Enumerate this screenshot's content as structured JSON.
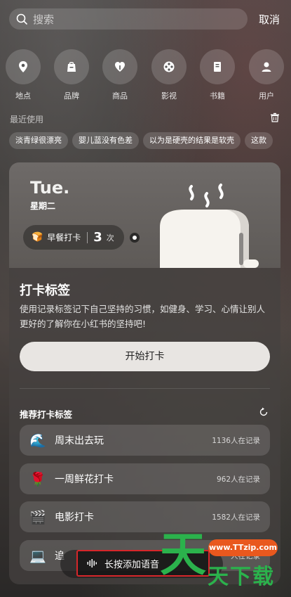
{
  "search": {
    "placeholder": "搜索",
    "cancel_label": "取消"
  },
  "categories": [
    {
      "label": "地点",
      "icon": "location-pin-icon"
    },
    {
      "label": "品牌",
      "icon": "shopping-bag-icon"
    },
    {
      "label": "商品",
      "icon": "heart-tag-icon"
    },
    {
      "label": "影视",
      "icon": "film-reel-icon"
    },
    {
      "label": "书籍",
      "icon": "book-icon"
    },
    {
      "label": "用户",
      "icon": "user-icon"
    }
  ],
  "recent": {
    "title": "最近使用",
    "chips": [
      "淡青绿很漂亮",
      "婴儿蓝没有色差",
      "以为是硬壳的结果是软壳",
      "这款"
    ]
  },
  "checkin_card": {
    "day": "Tue.",
    "weekday": "星期二",
    "pill": {
      "emoji": "🍞",
      "name": "早餐打卡",
      "count": "3",
      "unit": "次"
    },
    "title": "打卡标签",
    "description": "使用记录标签记下自己坚持的习惯，如健身、学习、心情让别人更好的了解你在小红书的坚持吧!",
    "start_button": "开始打卡",
    "recommend_title": "推荐打卡标签",
    "recommendations": [
      {
        "emoji": "🌊",
        "name": "周末出去玩",
        "count": "1136人在记录"
      },
      {
        "emoji": "🌹",
        "name": "一周鲜花打卡",
        "count": "962人在记录"
      },
      {
        "emoji": "🎬",
        "name": "电影打卡",
        "count": "1582人在记录"
      },
      {
        "emoji": "💻",
        "name": "追",
        "count": "人在记录"
      }
    ]
  },
  "voice": {
    "label": "长按添加语音"
  },
  "watermark": {
    "url": "www.TTzip.com",
    "big": "天",
    "small": "天下载"
  },
  "colors": {
    "accent_red": "#d6262a",
    "watermark_green": "#2bb24c",
    "watermark_orange": "#e9581e"
  }
}
